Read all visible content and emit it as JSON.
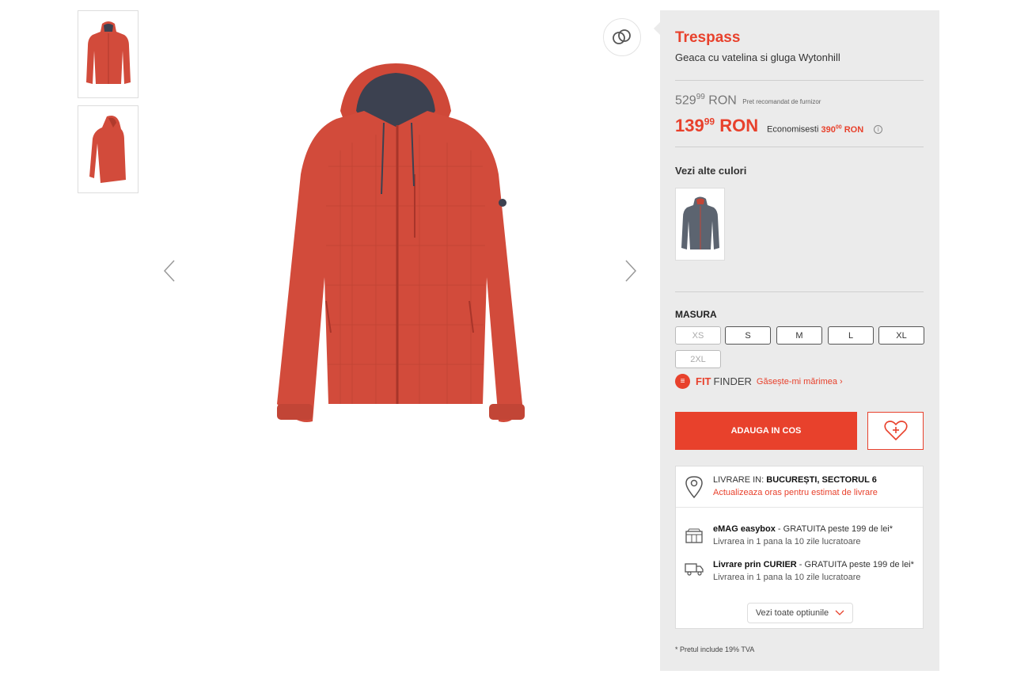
{
  "product": {
    "brand": "Trespass",
    "title": "Geaca cu vatelina si gluga Wytonhill",
    "colors": {
      "accent": "#e8412c",
      "jacket": "#d24b3b",
      "lining": "#3c4150",
      "panel_bg": "#ebebeb"
    }
  },
  "price": {
    "old_int": "529",
    "old_dec": "99",
    "old_currency": "RON",
    "old_note": "Pret recomandat de furnizor",
    "new_int": "139",
    "new_dec": "99",
    "new_currency": "RON",
    "savings_label": "Economisesti",
    "savings_int": "390",
    "savings_dec": "00",
    "savings_currency": "RON"
  },
  "other_colors": {
    "title": "Vezi alte culori"
  },
  "size": {
    "label": "MASURA",
    "options": [
      "XS",
      "S",
      "M",
      "L",
      "XL",
      "2XL"
    ],
    "disabled": [
      "XS",
      "2XL"
    ]
  },
  "fit_finder": {
    "fit": "FIT",
    "finder": "FINDER",
    "link": "Găsește-mi mărimea ›"
  },
  "cart": {
    "add_label": "ADAUGA IN COS"
  },
  "delivery": {
    "prefix": "LIVRARE IN:",
    "location": "BUCUREȘTI, SECTORUL 6",
    "update_link": "Actualizeaza oras pentru estimat de livrare",
    "options": [
      {
        "name": "eMAG easybox",
        "detail": " - GRATUITA peste 199 de lei*",
        "sub": "Livrarea in 1 pana la 10 zile lucratoare"
      },
      {
        "name": "Livrare prin CURIER",
        "detail": " - GRATUITA peste 199 de lei*",
        "sub": "Livrarea in 1 pana la 10 zile lucratoare"
      }
    ],
    "see_all": "Vezi toate optiunile"
  },
  "vat_note": "*  Pretul include 19% TVA"
}
